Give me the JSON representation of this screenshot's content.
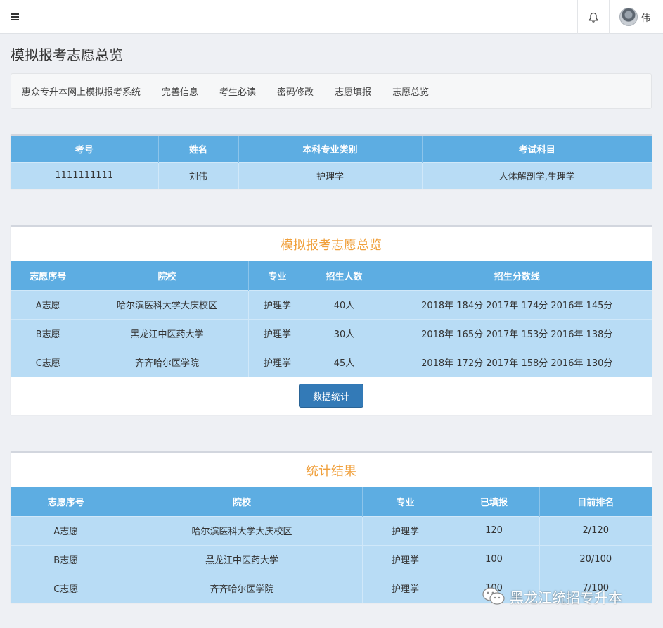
{
  "header": {
    "menu_icon": "hamburger-icon",
    "bell_icon": "bell-icon",
    "user_name": "伟"
  },
  "page_title": "模拟报考志愿总览",
  "nav": {
    "items": [
      "惠众专升本网上模拟报考系统",
      "完善信息",
      "考生必读",
      "密码修改",
      "志愿填报",
      "志愿总览"
    ]
  },
  "student": {
    "headers": [
      "考号",
      "姓名",
      "本科专业类别",
      "考试科目"
    ],
    "row": [
      "1111111111",
      "刘伟",
      "护理学",
      "人体解剖学,生理学"
    ]
  },
  "overview": {
    "title": "模拟报考志愿总览",
    "headers": [
      "志愿序号",
      "院校",
      "专业",
      "招生人数",
      "招生分数线"
    ],
    "rows": [
      [
        "A志愿",
        "哈尔滨医科大学大庆校区",
        "护理学",
        "40人",
        "2018年 184分 2017年 174分 2016年 145分"
      ],
      [
        "B志愿",
        "黑龙江中医药大学",
        "护理学",
        "30人",
        "2018年 165分 2017年 153分 2016年 138分"
      ],
      [
        "C志愿",
        "齐齐哈尔医学院",
        "护理学",
        "45人",
        "2018年 172分 2017年 158分 2016年 130分"
      ]
    ],
    "button_label": "数据统计"
  },
  "stats": {
    "title": "统计结果",
    "headers": [
      "志愿序号",
      "院校",
      "专业",
      "已填报",
      "目前排名"
    ],
    "rows": [
      [
        "A志愿",
        "哈尔滨医科大学大庆校区",
        "护理学",
        "120",
        "2/120"
      ],
      [
        "B志愿",
        "黑龙江中医药大学",
        "护理学",
        "100",
        "20/100"
      ],
      [
        "C志愿",
        "齐齐哈尔医学院",
        "护理学",
        "100",
        "7/100"
      ]
    ]
  },
  "watermark": {
    "icon": "wechat-icon",
    "text": "黑龙江统招专升本"
  },
  "colors": {
    "header_bg": "#5dade2",
    "row_bg": "#b8dcf5",
    "title_accent": "#f0a03c",
    "button_bg": "#337ab7"
  }
}
